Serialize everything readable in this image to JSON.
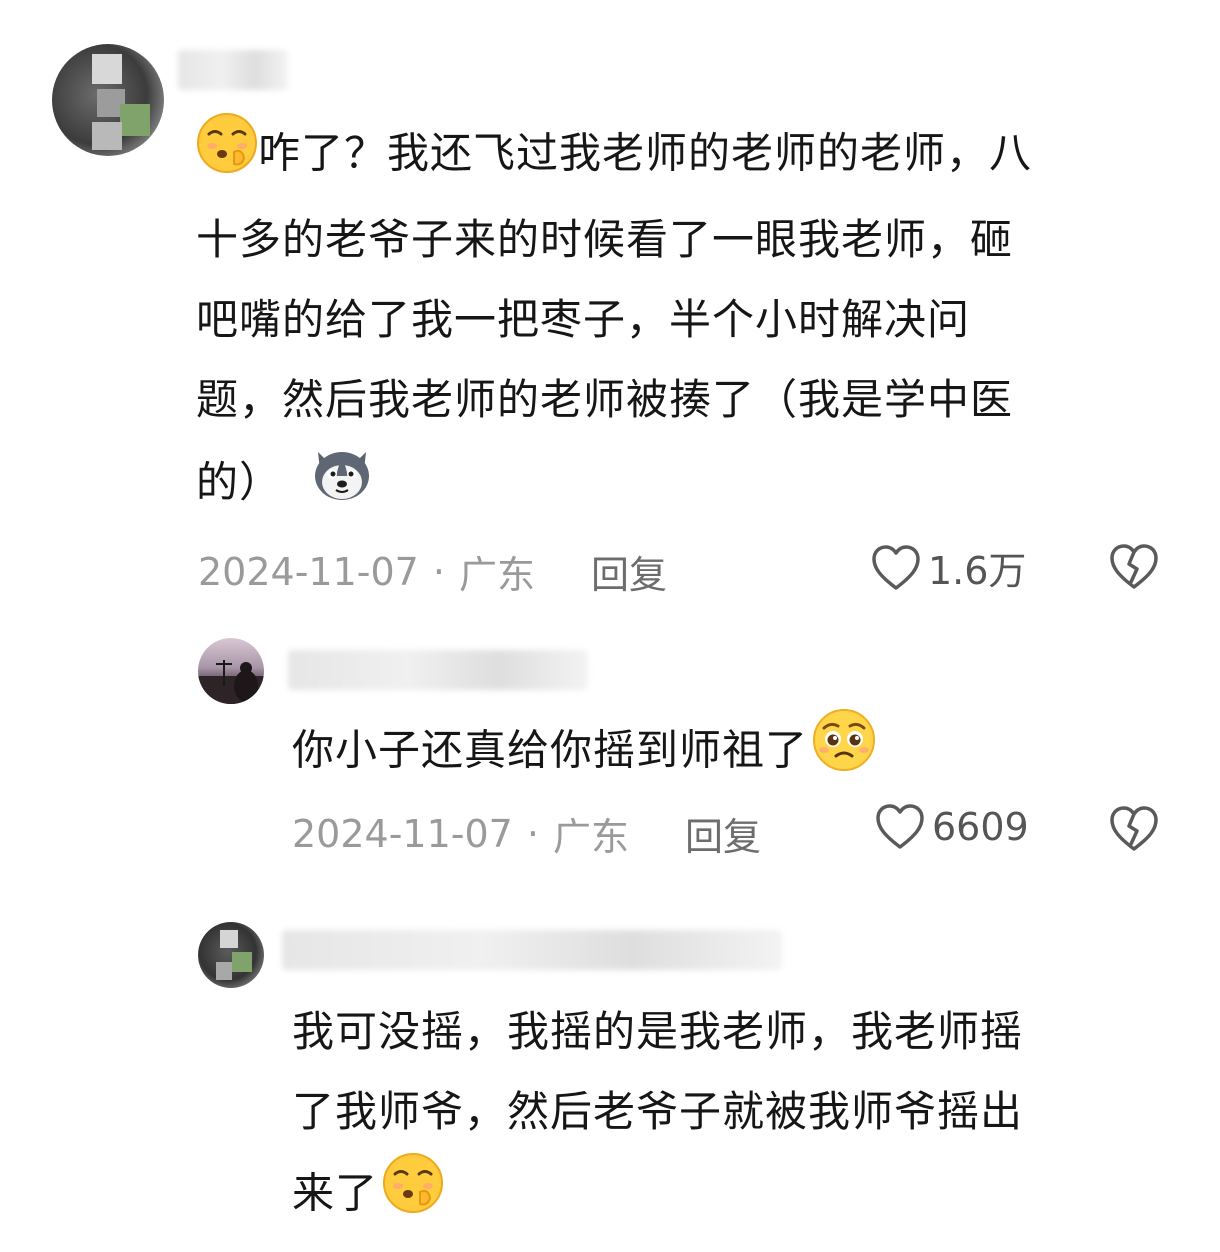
{
  "comments": [
    {
      "lines": [
        "咋了？我还飞过我老师的老师的老师，八",
        "十多的老爷子来的时候看了一眼我老师，砸",
        "吧嘴的给了我一把枣子，半个小时解决问",
        "题，然后我老师的老师被揍了（我是学中医",
        "的）"
      ],
      "lead_emoji": "shush-face-emoji",
      "trail_emoji": "husky-dog-emoji",
      "date": "2024-11-07",
      "sep": "·",
      "location": "广东",
      "reply_label": "回复",
      "likes": "1.6万"
    },
    {
      "lines": [
        "你小子还真给你摇到师祖了"
      ],
      "trail_emoji": "pleading-face-emoji",
      "date": "2024-11-07",
      "sep": "·",
      "location": "广东",
      "reply_label": "回复",
      "likes": "6609"
    },
    {
      "lines": [
        "我可没摇，我摇的是我老师，我老师摇",
        "了我师爷，然后老爷子就被我师爷摇出",
        "来了"
      ],
      "trail_emoji": "shush-face-emoji"
    }
  ],
  "icons": {
    "like": "heart-outline-icon",
    "dislike": "broken-heart-icon"
  },
  "colors": {
    "text": "#161616",
    "meta": "#9a9a9a",
    "reply": "#6d6d6d",
    "emoji_yellow": "#ffcc3d"
  }
}
